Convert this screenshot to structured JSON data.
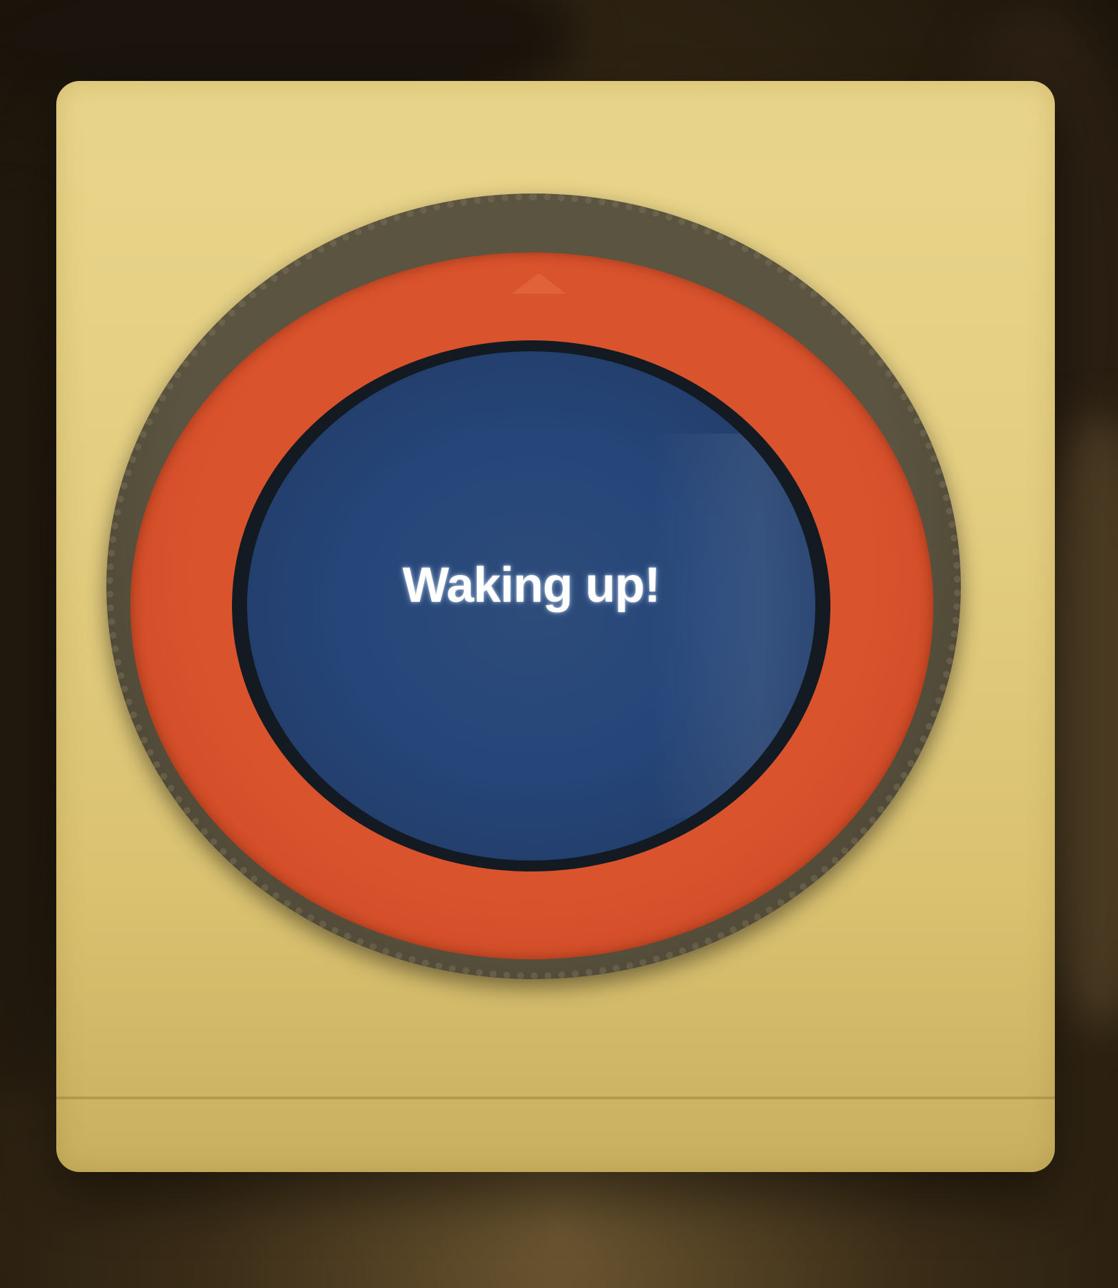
{
  "screen": {
    "message": "Waking up!"
  },
  "colors": {
    "device_body": "#e3cd80",
    "ring": "#d9532d",
    "screen": "#26467a",
    "text": "#ffffff"
  }
}
